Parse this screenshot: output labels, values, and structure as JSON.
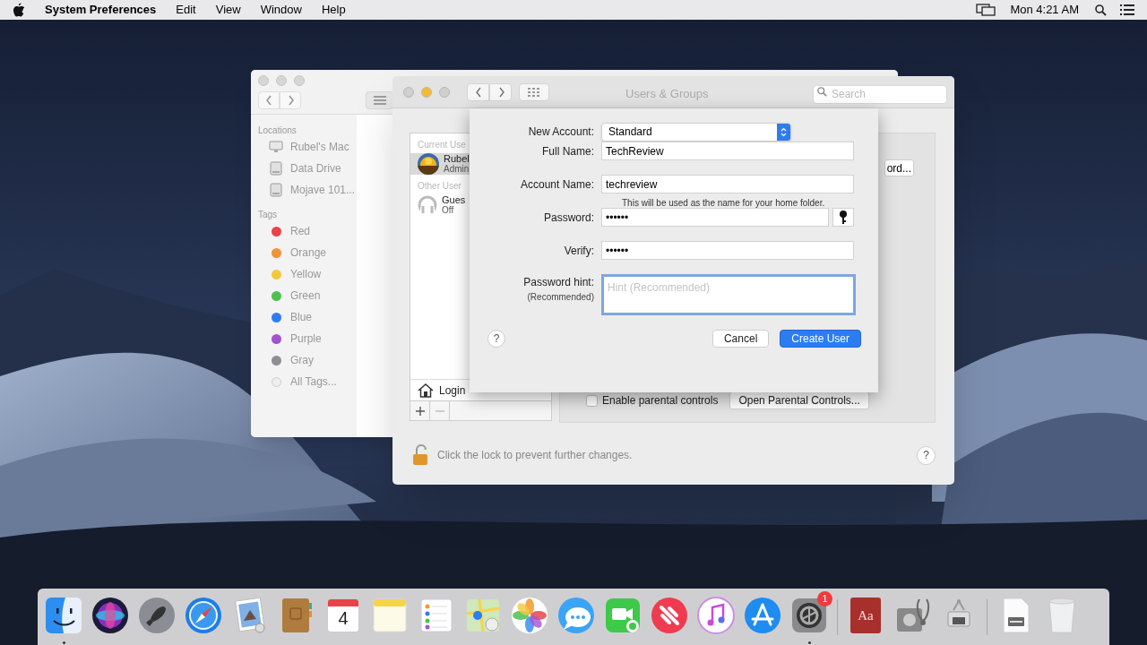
{
  "menu_bar": {
    "app": "System Preferences",
    "menus": [
      "Edit",
      "View",
      "Window",
      "Help"
    ],
    "clock": "Mon 4:21 AM"
  },
  "finder": {
    "sections": [
      {
        "title": "Locations",
        "items": [
          {
            "label": "Rubel's Mac",
            "kind": "computer"
          },
          {
            "label": "Data Drive",
            "kind": "disk"
          },
          {
            "label": "Mojave 101...",
            "kind": "disk"
          }
        ]
      },
      {
        "title": "Tags",
        "items": [
          {
            "label": "Red",
            "kind": "tag",
            "color": "#e8434b"
          },
          {
            "label": "Orange",
            "kind": "tag",
            "color": "#f0943a"
          },
          {
            "label": "Yellow",
            "kind": "tag",
            "color": "#f2c93c"
          },
          {
            "label": "Green",
            "kind": "tag",
            "color": "#4fc050"
          },
          {
            "label": "Blue",
            "kind": "tag",
            "color": "#2f7cf0"
          },
          {
            "label": "Purple",
            "kind": "tag",
            "color": "#a552cf"
          },
          {
            "label": "Gray",
            "kind": "tag",
            "color": "#8e8e93"
          },
          {
            "label": "All Tags...",
            "kind": "all-tags"
          }
        ]
      }
    ]
  },
  "users_window": {
    "title": "Users & Groups",
    "search": {
      "placeholder": "Search"
    },
    "users": [
      {
        "kind": "header",
        "label": "Current Use"
      },
      {
        "kind": "member",
        "name": "Rubel",
        "role": "Admin",
        "selected": true
      },
      {
        "kind": "header",
        "label": "Other User"
      },
      {
        "kind": "guest",
        "name": "Gues",
        "role": "Off",
        "selected": false
      }
    ],
    "login_options": "Login",
    "password_button": "ord...",
    "parental": {
      "label": "Enable parental controls",
      "checked": false
    },
    "parental_button": "Open Parental Controls...",
    "lock_text": "Click the lock to prevent further changes.",
    "help": "?"
  },
  "sheet": {
    "new_account": {
      "label": "New Account:",
      "value": "Standard"
    },
    "fields": [
      {
        "kind": "text",
        "label": "Full Name:",
        "value": "TechReview"
      },
      {
        "kind": "text",
        "label": "Account Name:",
        "value": "techreview",
        "note": "This will be used as the name for your home folder."
      },
      {
        "kind": "password",
        "label": "Password:",
        "value": "••••••"
      },
      {
        "kind": "text",
        "label": "Verify:",
        "value": "••••••"
      },
      {
        "kind": "hint",
        "label": "Password hint:",
        "sublabel": "(Recommended)",
        "placeholder": "Hint (Recommended)",
        "focused": true
      }
    ],
    "help": "?",
    "buttons": [
      {
        "label": "Cancel",
        "default": false
      },
      {
        "label": "Create User",
        "default": true
      }
    ]
  },
  "dock": [
    {
      "kind": "finder",
      "running": true
    },
    {
      "kind": "siri",
      "running": false
    },
    {
      "kind": "launchpad",
      "running": false
    },
    {
      "kind": "safari",
      "running": false
    },
    {
      "kind": "preview",
      "running": false
    },
    {
      "kind": "contacts",
      "running": false
    },
    {
      "kind": "calendar",
      "text": "4",
      "running": false
    },
    {
      "kind": "notes",
      "running": false
    },
    {
      "kind": "reminders",
      "running": false
    },
    {
      "kind": "maps",
      "running": false
    },
    {
      "kind": "photos",
      "running": false
    },
    {
      "kind": "messages",
      "running": false
    },
    {
      "kind": "facetime",
      "running": false
    },
    {
      "kind": "news",
      "running": false
    },
    {
      "kind": "itunes",
      "running": false
    },
    {
      "kind": "appstore",
      "running": false
    },
    {
      "kind": "sysprefs",
      "badge": "1",
      "running": true
    },
    {
      "kind": "separator"
    },
    {
      "kind": "dictionary",
      "text": "Aa",
      "running": false
    },
    {
      "kind": "diskutility",
      "running": false
    },
    {
      "kind": "scanner",
      "running": false
    },
    {
      "kind": "separator"
    },
    {
      "kind": "document",
      "running": false
    },
    {
      "kind": "trash",
      "running": false
    }
  ]
}
